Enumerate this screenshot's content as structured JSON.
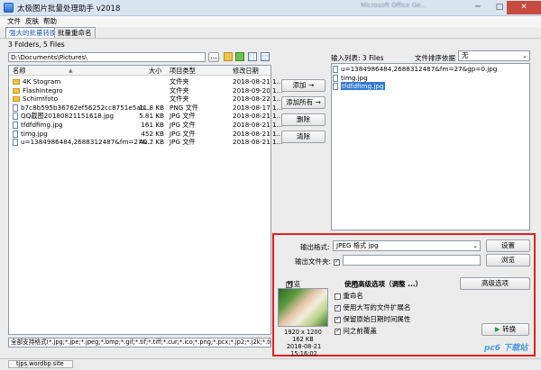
{
  "window": {
    "title": "太极图片批量处理助手 v2018",
    "bg_title": "Microsoft Office Ge..."
  },
  "menu": [
    "文件",
    "皮肤",
    "帮助"
  ],
  "tabs": [
    {
      "label": "强大的批量转换",
      "active": true
    },
    {
      "label": "批量重命名",
      "active": false
    }
  ],
  "summary": "3 Folders, 5 Files",
  "path": {
    "value": "D:\\Documents\\Pictures\\",
    "browse_label": "..."
  },
  "file_list": {
    "headers": {
      "name": "名称",
      "size": "大小",
      "type": "项目类型",
      "date": "修改日期"
    },
    "rows": [
      {
        "name": "4K Stogram",
        "size": "",
        "type": "文件夹",
        "date": "2018-08-21 1...",
        "kind": "folder"
      },
      {
        "name": "FlashIntegro",
        "size": "",
        "type": "文件夹",
        "date": "2018-09-20 1...",
        "kind": "folder"
      },
      {
        "name": "Schirmfoto",
        "size": "",
        "type": "文件夹",
        "date": "2018-08-22 1...",
        "kind": "folder"
      },
      {
        "name": "b7c8b595b36762ef56252cc8751e5ab...",
        "size": "11.8 KB",
        "type": "PNG 文件",
        "date": "2018-08-17 1...",
        "kind": "file"
      },
      {
        "name": "QQ截图20180821151618.jpg",
        "size": "5.81 KB",
        "type": "JPG 文件",
        "date": "2018-08-21 1...",
        "kind": "file"
      },
      {
        "name": "tfdfdfimg.jpg",
        "size": "161 KB",
        "type": "JPG 文件",
        "date": "2018-08-21 1...",
        "kind": "file"
      },
      {
        "name": "timg.jpg",
        "size": "452 KB",
        "type": "JPG 文件",
        "date": "2018-08-21 1...",
        "kind": "file"
      },
      {
        "name": "u=1384986484,2688312487&fm=27&...",
        "size": "40.7 KB",
        "type": "JPG 文件",
        "date": "2018-08-21 1...",
        "kind": "file"
      }
    ]
  },
  "filter": "全部支持格式(*.jpg;*.jpe;*.jpeg;*.bmp;*.gif;*.tif;*.tiff;*.cur;*.ico;*.png;*.pcx;*.jp2;*.j2k;*.tga",
  "mid_buttons": {
    "add": "添加 →",
    "add_all": "添加所有 →",
    "remove": "删除",
    "clear": "清除"
  },
  "input_list": {
    "label": "输入列表: 3 Files",
    "sort_label": "文件排序依据",
    "sort_value": "无",
    "items": [
      {
        "name": "u=1384986484,2688312487&fm=27&gp=0.jpg",
        "selected": false
      },
      {
        "name": "timg.jpg",
        "selected": false
      },
      {
        "name": "tfdfdfimg.jpg",
        "selected": true
      }
    ]
  },
  "output": {
    "format_label": "输出格式:",
    "format_value": "JPEG 格式 jpg",
    "settings_button": "设置",
    "folder_label": "输出文件夹:",
    "folder_value": "",
    "browse_button": "浏览",
    "preview_label": "预览",
    "advanced_label": "使用高级选项（调整 ...）",
    "advanced_button": "高级选项",
    "options": [
      {
        "label": "重命名",
        "checked": false
      },
      {
        "label": "使用大写的文件扩展名",
        "checked": true
      },
      {
        "label": "保留原始日期时间属性",
        "checked": true
      },
      {
        "label": "问之前覆盖",
        "checked": true
      }
    ],
    "preview_info": {
      "dims": "1920 x 1200",
      "size": "162 KB",
      "date": "2018-08-21 15:16:02"
    },
    "convert_button": "转换"
  },
  "status": {
    "text": "tjps.wordbp.site"
  },
  "watermark": "pc6 下载站",
  "colors": {
    "highlight": "#e02020",
    "select": "#3079d0"
  }
}
